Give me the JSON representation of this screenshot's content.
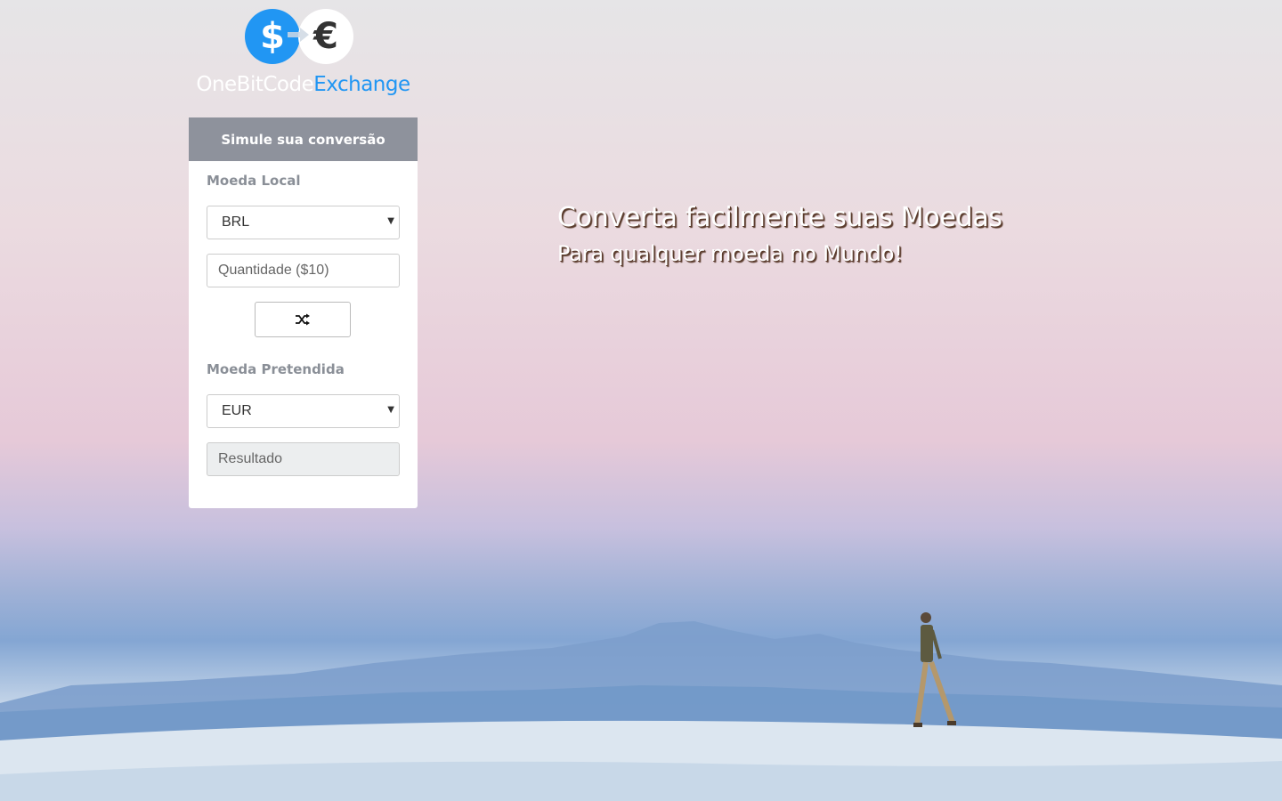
{
  "brand": {
    "name_light": "OneBitCode",
    "name_strong": "Exchange",
    "dollar_symbol": "$",
    "euro_symbol": "€",
    "accent_color": "#2196f3"
  },
  "converter": {
    "header": "Simule sua conversão",
    "local_label": "Moeda Local",
    "local_value": "BRL",
    "amount_placeholder": "Quantidade ($10)",
    "swap_icon": "shuffle-icon",
    "target_label": "Moeda Pretendida",
    "target_value": "EUR",
    "result_placeholder": "Resultado",
    "header_color": "#8e929c"
  },
  "hero": {
    "title": "Converta facilmente suas Moedas",
    "subtitle": "Para qualquer moeda no Mundo!"
  }
}
